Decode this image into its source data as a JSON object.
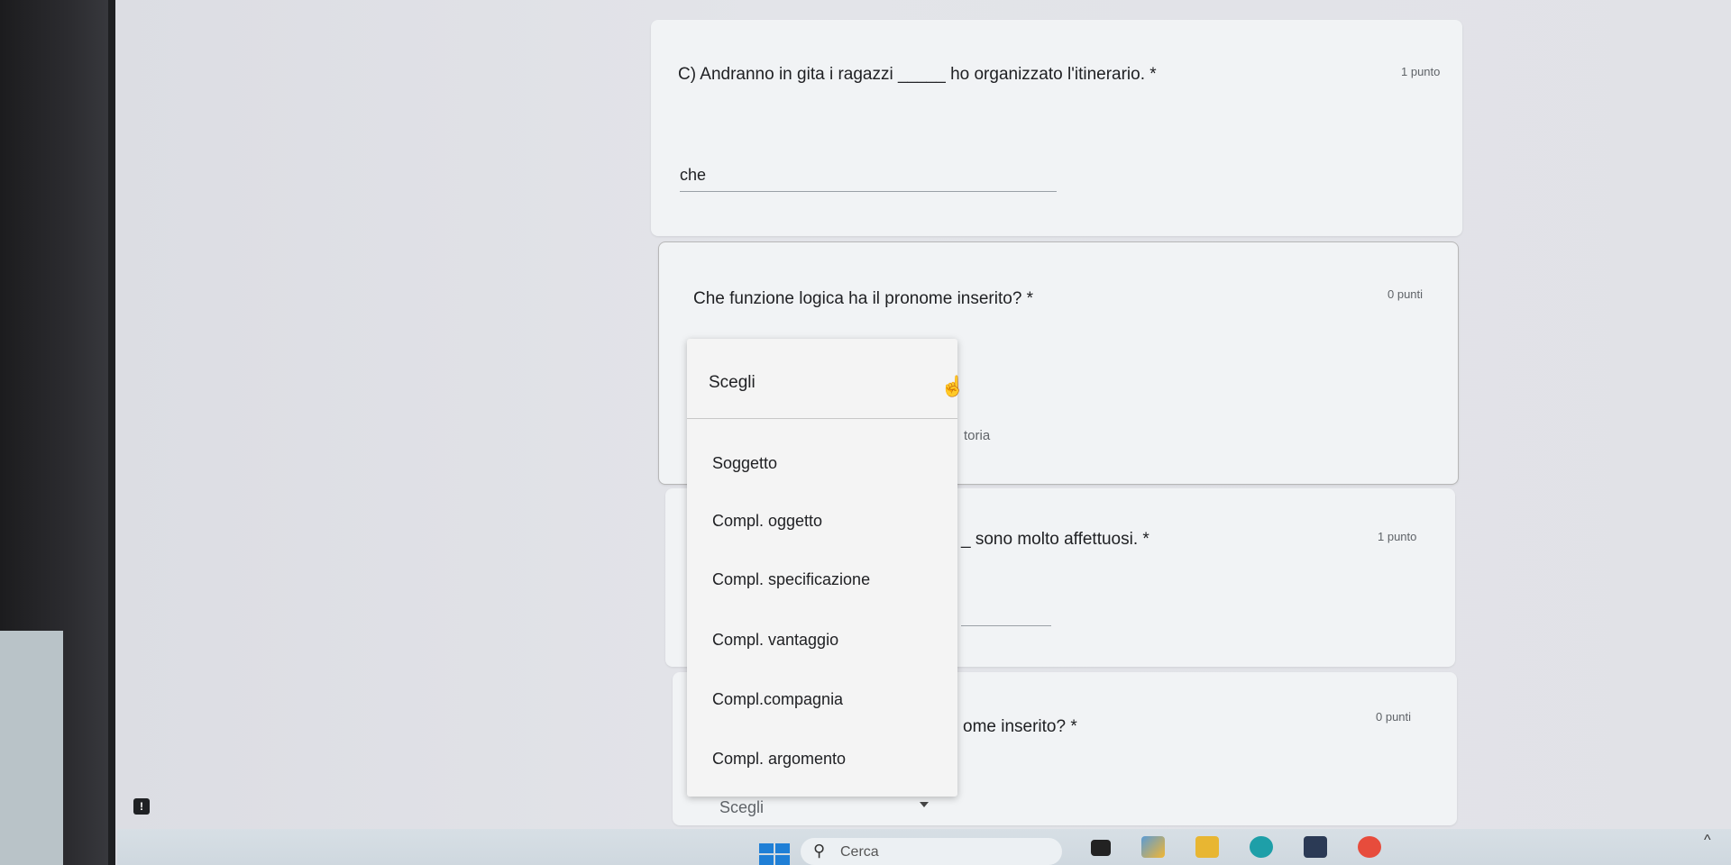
{
  "questions": [
    {
      "text": "C) Andranno in gita i ragazzi _____ ho organizzato l'itinerario. *",
      "points": "1 punto",
      "answer": "che"
    },
    {
      "text": "Che funzione logica ha il pronome inserito? *",
      "points": "0 punti",
      "partial_visible": "toria"
    },
    {
      "text": "_ sono molto affettuosi. *",
      "points": "1 punto"
    },
    {
      "text": "ome inserito? *",
      "points": "0 punti"
    }
  ],
  "dropdown": {
    "header": "Scegli",
    "options": [
      "Soggetto",
      "Compl. oggetto",
      "Compl. specificazione",
      "Compl. vantaggio",
      "Compl.compagnia",
      "Compl. argomento"
    ]
  },
  "second_select": {
    "value": "Scegli"
  },
  "taskbar": {
    "search_placeholder": "Cerca"
  },
  "colors": {
    "card_bg": "#f1f3f5",
    "accent_blue": "#1f7fd6"
  }
}
